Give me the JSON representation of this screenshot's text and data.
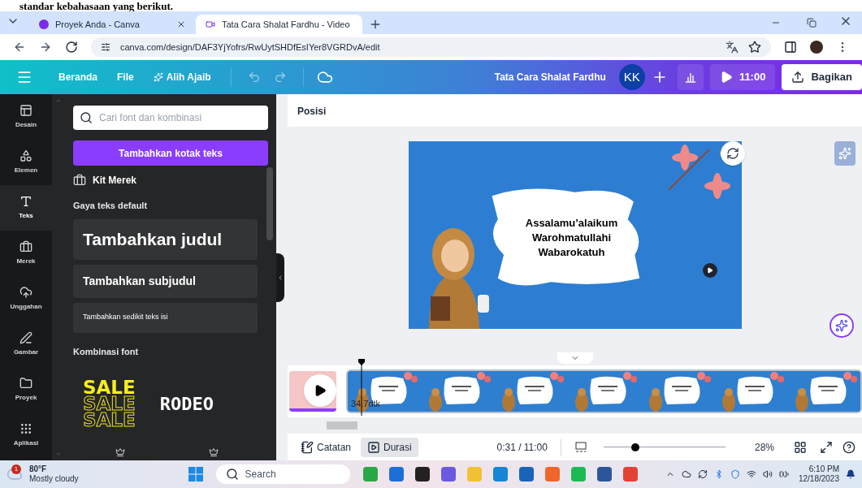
{
  "document_snippet": "standar kebahasaan yang berikut.",
  "browser": {
    "tabs": [
      {
        "title": "Proyek Anda - Canva",
        "selected": false
      },
      {
        "title": "Tata Cara Shalat Fardhu - Video",
        "selected": true
      }
    ],
    "url": "canva.com/design/DAF3YjYofrs/RwUytSHDfEsIYer8VGRDvA/edit"
  },
  "toolbar": {
    "menu": [
      "Beranda",
      "File",
      "Alih Ajaib"
    ],
    "design_title": "Tata Cara Shalat Fardhu",
    "avatar": "KK",
    "duration": "11:00",
    "share": "Bagikan"
  },
  "sidebar": {
    "items": [
      {
        "label": "Desain",
        "selected": false
      },
      {
        "label": "Elemen",
        "selected": false
      },
      {
        "label": "Teks",
        "selected": true
      },
      {
        "label": "Merek",
        "selected": false
      },
      {
        "label": "Unggahan",
        "selected": false
      },
      {
        "label": "Gambar",
        "selected": false
      },
      {
        "label": "Proyek",
        "selected": false
      },
      {
        "label": "Aplikasi",
        "selected": false
      }
    ]
  },
  "panel": {
    "search_placeholder": "Cari font dan kombinasi",
    "add_button": "Tambahkan kotak teks",
    "brand_kit": "Kit Merek",
    "default_styles_heading": "Gaya teks default",
    "styles": [
      {
        "kind": "heading",
        "label": "Tambahkan judul"
      },
      {
        "kind": "subheading",
        "label": "Tambahkan subjudul"
      },
      {
        "kind": "body",
        "label": "Tambahkan sedikit teks isi"
      }
    ],
    "combinations_heading": "Kombinasi font",
    "combinations": [
      {
        "kind": "stacked",
        "lines": [
          "SALE",
          "SALE",
          "SALE"
        ]
      },
      {
        "kind": "single",
        "lines": [
          "RODEO"
        ]
      }
    ]
  },
  "editor": {
    "toolbar_label": "Posisi",
    "slide_text": [
      "Assalamu’alaikum",
      "Warohmatullahi",
      "Wabarokatuh"
    ],
    "timeline": {
      "clip_duration": "34.7dtk"
    },
    "footer": {
      "buttons": [
        {
          "label": "Catatan",
          "selected": false
        },
        {
          "label": "Durasi",
          "selected": true
        }
      ],
      "time": "0:31 / 11:00",
      "level": 0.26,
      "zoom": "28%"
    }
  },
  "taskbar": {
    "weather": {
      "badge": "1",
      "temp": "80°F",
      "condition": "Mostly cloudy"
    },
    "search": "Search",
    "time": "6:10 PM",
    "date": "12/18/2023"
  }
}
